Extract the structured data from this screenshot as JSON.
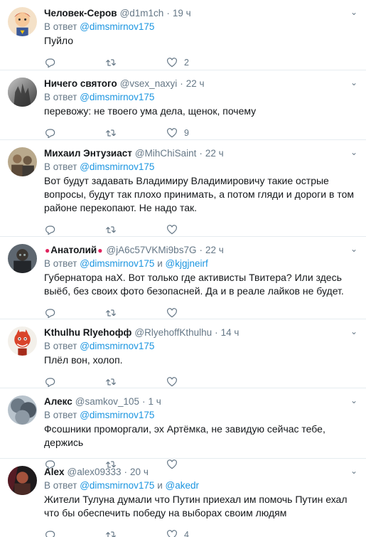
{
  "reply_prefix": "В ответ",
  "and_word": "и",
  "tweets": [
    {
      "name": "Человек-Серов",
      "handle": "@d1m1ch",
      "time": "19 ч",
      "reply_to": [
        "@dimsmirnov175"
      ],
      "text": "Пуйло",
      "likes": "2"
    },
    {
      "name": "Ничего святого",
      "handle": "@vsex_naxyi",
      "time": "22 ч",
      "reply_to": [
        "@dimsmirnov175"
      ],
      "text": "перевожу: не твоего ума дела, щенок, почему",
      "likes": "9"
    },
    {
      "name": "Михаил Энтузиаст",
      "handle": "@MihChiSaint",
      "time": "22 ч",
      "reply_to": [
        "@dimsmirnov175"
      ],
      "text": "Вот будут задавать Владимиру Владимировичу такие острые вопросы, будут так плохо принимать, а потом гляди и дороги в том районе перекопают. Не надо так.",
      "likes": ""
    },
    {
      "name": "Анатолий",
      "handle": "@jA6c57VKMi9bs7G",
      "time": "22 ч",
      "reply_to": [
        "@dimsmirnov175",
        "@kjgjneirf"
      ],
      "text": "Губернатора наХ. Вот только где активисты Твитера? Или здесь выёб, без своих фото безопасней. Да и в реале лайков не будет.",
      "likes": ""
    },
    {
      "name": "Kthulhu Rlyehoфф",
      "handle": "@RlyehoffKthulhu",
      "time": "14 ч",
      "reply_to": [
        "@dimsmirnov175"
      ],
      "text": "Плёл вон, холоп.",
      "likes": ""
    },
    {
      "name": "Алекс",
      "handle": "@samkov_105",
      "time": "1 ч",
      "reply_to": [
        "@dimsmirnov175"
      ],
      "text": "Фсошники проморгали, эх Артёмка, не завидую сейчас тебе, держись",
      "likes": ""
    },
    {
      "name": "Alex",
      "handle": "@alex09333",
      "time": "20 ч",
      "reply_to": [
        "@dimsmirnov175",
        "@akedr"
      ],
      "text": "Жители Тулуна думали что Путин приехал им помочь Путин ехал что бы обеспечить победу на выборах своим людям",
      "likes": "4"
    }
  ],
  "icons": {
    "reply": "reply-icon",
    "retweet": "retweet-icon",
    "like": "heart-icon",
    "caret": "chevron-down-icon",
    "pin": "round-pushpin-emoji"
  },
  "colors": {
    "link": "#1b95e0",
    "muted": "#657786",
    "text": "#14171a",
    "divider": "#e6ecf0",
    "pin": "#e0245e"
  }
}
